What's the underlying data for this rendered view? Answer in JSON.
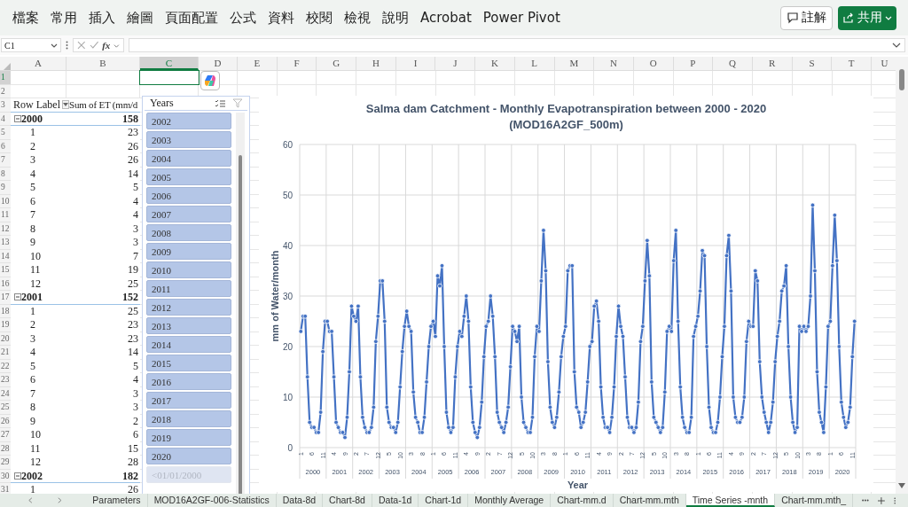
{
  "menu_bar": {
    "items": [
      "檔案",
      "常用",
      "插入",
      "繪圖",
      "頁面配置",
      "公式",
      "資料",
      "校閱",
      "檢視",
      "說明",
      "Acrobat",
      "Power Pivot"
    ],
    "comment_button": "註解",
    "share_button": "共用"
  },
  "formula_bar": {
    "name_box": "C1",
    "fx": "fx"
  },
  "column_headers": [
    {
      "label": "A",
      "selected": false
    },
    {
      "label": "B",
      "selected": false
    },
    {
      "label": "C",
      "selected": true
    },
    {
      "label": "D",
      "selected": false
    },
    {
      "label": "E",
      "selected": false
    },
    {
      "label": "F",
      "selected": false
    },
    {
      "label": "G",
      "selected": false
    },
    {
      "label": "H",
      "selected": false
    },
    {
      "label": "I",
      "selected": false
    },
    {
      "label": "J",
      "selected": false
    },
    {
      "label": "K",
      "selected": false
    },
    {
      "label": "L",
      "selected": false
    },
    {
      "label": "M",
      "selected": false
    },
    {
      "label": "N",
      "selected": false
    },
    {
      "label": "O",
      "selected": false
    },
    {
      "label": "P",
      "selected": false
    },
    {
      "label": "Q",
      "selected": false
    },
    {
      "label": "R",
      "selected": false
    },
    {
      "label": "S",
      "selected": false
    },
    {
      "label": "T",
      "selected": false
    },
    {
      "label": "U",
      "selected": false
    }
  ],
  "row_headers": [
    {
      "label": "1",
      "selected": true
    },
    {
      "label": "2",
      "selected": false
    },
    {
      "label": "3",
      "selected": false
    },
    {
      "label": "4",
      "selected": false
    },
    {
      "label": "5",
      "selected": false
    },
    {
      "label": "6",
      "selected": false
    },
    {
      "label": "7",
      "selected": false
    },
    {
      "label": "8",
      "selected": false
    },
    {
      "label": "9",
      "selected": false
    },
    {
      "label": "10",
      "selected": false
    },
    {
      "label": "11",
      "selected": false
    },
    {
      "label": "12",
      "selected": false
    },
    {
      "label": "13",
      "selected": false
    },
    {
      "label": "14",
      "selected": false
    },
    {
      "label": "15",
      "selected": false
    },
    {
      "label": "16",
      "selected": false
    },
    {
      "label": "17",
      "selected": false
    },
    {
      "label": "18",
      "selected": false
    },
    {
      "label": "19",
      "selected": false
    },
    {
      "label": "20",
      "selected": false
    },
    {
      "label": "21",
      "selected": false
    },
    {
      "label": "22",
      "selected": false
    },
    {
      "label": "23",
      "selected": false
    },
    {
      "label": "24",
      "selected": false
    },
    {
      "label": "25",
      "selected": false
    },
    {
      "label": "26",
      "selected": false
    },
    {
      "label": "27",
      "selected": false
    },
    {
      "label": "28",
      "selected": false
    },
    {
      "label": "29",
      "selected": false
    },
    {
      "label": "30",
      "selected": false
    },
    {
      "label": "31",
      "selected": false
    }
  ],
  "pivot": {
    "header_label": "Row Label",
    "header_value": "Sum of ET (mm/d",
    "rows": [
      {
        "kind": "year",
        "label": "2000",
        "value": "158",
        "expanded": true
      },
      {
        "kind": "month",
        "label": "1",
        "value": "23"
      },
      {
        "kind": "month",
        "label": "2",
        "value": "26"
      },
      {
        "kind": "month",
        "label": "3",
        "value": "26"
      },
      {
        "kind": "month",
        "label": "4",
        "value": "14"
      },
      {
        "kind": "month",
        "label": "5",
        "value": "5"
      },
      {
        "kind": "month",
        "label": "6",
        "value": "4"
      },
      {
        "kind": "month",
        "label": "7",
        "value": "4"
      },
      {
        "kind": "month",
        "label": "8",
        "value": "3"
      },
      {
        "kind": "month",
        "label": "9",
        "value": "3"
      },
      {
        "kind": "month",
        "label": "10",
        "value": "7"
      },
      {
        "kind": "month",
        "label": "11",
        "value": "19"
      },
      {
        "kind": "month",
        "label": "12",
        "value": "25"
      },
      {
        "kind": "year",
        "label": "2001",
        "value": "152",
        "expanded": true
      },
      {
        "kind": "month",
        "label": "1",
        "value": "25"
      },
      {
        "kind": "month",
        "label": "2",
        "value": "23"
      },
      {
        "kind": "month",
        "label": "3",
        "value": "23"
      },
      {
        "kind": "month",
        "label": "4",
        "value": "14"
      },
      {
        "kind": "month",
        "label": "5",
        "value": "5"
      },
      {
        "kind": "month",
        "label": "6",
        "value": "4"
      },
      {
        "kind": "month",
        "label": "7",
        "value": "3"
      },
      {
        "kind": "month",
        "label": "8",
        "value": "3"
      },
      {
        "kind": "month",
        "label": "9",
        "value": "2"
      },
      {
        "kind": "month",
        "label": "10",
        "value": "6"
      },
      {
        "kind": "month",
        "label": "11",
        "value": "15"
      },
      {
        "kind": "month",
        "label": "12",
        "value": "28"
      },
      {
        "kind": "year",
        "label": "2002",
        "value": "182",
        "expanded": true
      },
      {
        "kind": "month",
        "label": "1",
        "value": "26"
      }
    ]
  },
  "slicer": {
    "title": "Years",
    "items": [
      {
        "label": "2002",
        "selected": true
      },
      {
        "label": "2003",
        "selected": true
      },
      {
        "label": "2004",
        "selected": true
      },
      {
        "label": "2005",
        "selected": true
      },
      {
        "label": "2006",
        "selected": true
      },
      {
        "label": "2007",
        "selected": true
      },
      {
        "label": "2008",
        "selected": true
      },
      {
        "label": "2009",
        "selected": true
      },
      {
        "label": "2010",
        "selected": true
      },
      {
        "label": "2011",
        "selected": true
      },
      {
        "label": "2012",
        "selected": true
      },
      {
        "label": "2013",
        "selected": true
      },
      {
        "label": "2014",
        "selected": true
      },
      {
        "label": "2015",
        "selected": true
      },
      {
        "label": "2016",
        "selected": true
      },
      {
        "label": "2017",
        "selected": true
      },
      {
        "label": "2018",
        "selected": true
      },
      {
        "label": "2019",
        "selected": true
      },
      {
        "label": "2020",
        "selected": true
      },
      {
        "label": "<01/01/2000",
        "selected": false
      }
    ]
  },
  "chart": {
    "chart_data": {
      "type": "line",
      "title": "Salma dam Catchment - Monthly Evapotranspiration between 2000 - 2020 (MOD16A2GF_500m)",
      "xlabel": "Year",
      "ylabel": "mm of Water/month",
      "ylim": [
        0,
        60
      ],
      "yticks": [
        0,
        10,
        20,
        30,
        40,
        50,
        60
      ],
      "grid": true,
      "categories": [
        "1",
        null,
        null,
        null,
        null,
        "6",
        null,
        null,
        null,
        null,
        "11",
        null,
        null,
        null,
        null,
        "4",
        null,
        null,
        null,
        null,
        "9",
        null,
        null,
        null,
        null,
        "2",
        null,
        null,
        null,
        null,
        "7",
        null,
        null,
        null,
        null,
        "12",
        null,
        null,
        null,
        null,
        "5",
        null,
        null,
        null,
        null,
        "10",
        null,
        null,
        null,
        null,
        "3",
        null,
        null,
        null,
        null,
        "8",
        null,
        null,
        null,
        null,
        "1",
        null,
        null,
        null,
        null,
        "6",
        null,
        null,
        null,
        null,
        "11",
        null,
        null,
        null,
        null,
        "4",
        null,
        null,
        null,
        null,
        "9",
        null,
        null,
        null,
        null,
        "2",
        null,
        null,
        null,
        null,
        "7",
        null,
        null,
        null,
        null,
        "12",
        null,
        null,
        null,
        null,
        "5",
        null,
        null,
        null,
        null,
        "10",
        null,
        null,
        null,
        null,
        "3",
        null,
        null,
        null,
        null,
        "8",
        null,
        null,
        null,
        null,
        "1",
        null,
        null,
        null,
        null,
        "6",
        null,
        null,
        null,
        null,
        "11",
        null,
        null,
        null,
        null,
        "4",
        null,
        null,
        null,
        null,
        "9",
        null,
        null,
        null,
        null,
        "2",
        null,
        null,
        null,
        null,
        "7",
        null,
        null,
        null,
        null,
        "12",
        null,
        null,
        null,
        null,
        "5",
        null,
        null,
        null,
        null,
        "10",
        null,
        null,
        null,
        null,
        "3",
        null,
        null,
        null,
        null,
        "8",
        null,
        null,
        null,
        null,
        "1",
        null,
        null,
        null,
        null,
        "6",
        null,
        null,
        null,
        null,
        "11",
        null,
        null,
        null,
        null,
        "4",
        null,
        null,
        null,
        null,
        "9",
        null,
        null,
        null,
        null,
        "2",
        null,
        null,
        null,
        null,
        "7",
        null,
        null,
        null,
        null,
        "12",
        null,
        null,
        null,
        null,
        "5",
        null,
        null,
        null,
        null,
        "10",
        null,
        null,
        null,
        null,
        "3",
        null,
        null,
        null,
        null,
        "8",
        null,
        null,
        null,
        null,
        "1",
        null,
        null,
        null,
        null,
        "6",
        null,
        null,
        null,
        null,
        "11",
        null
      ],
      "series": [
        {
          "color": "#4472c4",
          "marker": true,
          "values": [
            23,
            26,
            26,
            14,
            5,
            4,
            4,
            3,
            3,
            7,
            19,
            25,
            25,
            23,
            23,
            14,
            5,
            4,
            3,
            3,
            2,
            6,
            15,
            28,
            26,
            25,
            28,
            14,
            6,
            4,
            3,
            3,
            4,
            8,
            21,
            26,
            33,
            33,
            25,
            8,
            5,
            4,
            4,
            3,
            5,
            12,
            19,
            24,
            27,
            24,
            23,
            11,
            6,
            5,
            3,
            3,
            6,
            13,
            20,
            24,
            25,
            22,
            34,
            32,
            36,
            20,
            7,
            4,
            3,
            4,
            14,
            20,
            23,
            22,
            26,
            30,
            25,
            12,
            5,
            3,
            2,
            4,
            9,
            18,
            24,
            25,
            30,
            26,
            18,
            7,
            5,
            4,
            3,
            5,
            8,
            16,
            24,
            23,
            21,
            24,
            10,
            5,
            4,
            3,
            3,
            6,
            18,
            24,
            23,
            33,
            43,
            35,
            17,
            8,
            5,
            4,
            6,
            11,
            18,
            22,
            24,
            35,
            36,
            36,
            15,
            8,
            7,
            4,
            5,
            7,
            13,
            20,
            21,
            28,
            29,
            25,
            12,
            6,
            4,
            4,
            3,
            6,
            12,
            22,
            28,
            24,
            22,
            14,
            6,
            4,
            4,
            3,
            4,
            9,
            21,
            24,
            33,
            41,
            34,
            13,
            6,
            5,
            4,
            3,
            4,
            11,
            23,
            24,
            23,
            37,
            43,
            25,
            12,
            6,
            4,
            3,
            3,
            6,
            22,
            24,
            26,
            31,
            39,
            38,
            20,
            8,
            4,
            3,
            3,
            5,
            10,
            18,
            24,
            38,
            42,
            31,
            10,
            6,
            5,
            5,
            6,
            10,
            21,
            25,
            24,
            24,
            35,
            33,
            17,
            10,
            7,
            5,
            3,
            5,
            9,
            17,
            22,
            25,
            31,
            32,
            36,
            20,
            10,
            5,
            3,
            4,
            24,
            23,
            24,
            23,
            24,
            30,
            48,
            35,
            15,
            7,
            5,
            3,
            12,
            24,
            25,
            36,
            46,
            37,
            20,
            9,
            6,
            4,
            5,
            8,
            18,
            25
          ]
        }
      ]
    },
    "year_labels": [
      "2000",
      "2001",
      "2002",
      "2003",
      "2004",
      "2005",
      "2006",
      "2007",
      "2008",
      "2009",
      "2010",
      "2011",
      "2012",
      "2013",
      "2014",
      "2015",
      "2016",
      "2017",
      "2018",
      "2019",
      "2020"
    ]
  },
  "sheet_tabs": [
    {
      "label": "Parameters",
      "selected": false
    },
    {
      "label": "MOD16A2GF-006-Statistics",
      "selected": false
    },
    {
      "label": "Data-8d",
      "selected": false
    },
    {
      "label": "Chart-8d",
      "selected": false
    },
    {
      "label": "Data-1d",
      "selected": false
    },
    {
      "label": "Chart-1d",
      "selected": false
    },
    {
      "label": "Monthly Average",
      "selected": false
    },
    {
      "label": "Chart-mm.d",
      "selected": false
    },
    {
      "label": "Chart-mm.mth",
      "selected": false
    },
    {
      "label": "Time Series -mnth",
      "selected": true
    },
    {
      "label": "Chart-mm.mth_",
      "selected": false
    }
  ]
}
